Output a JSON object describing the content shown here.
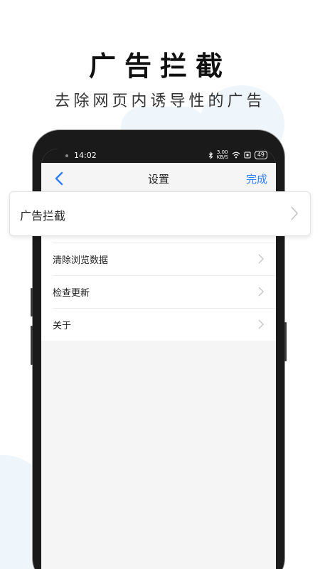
{
  "promo": {
    "title": "广告拦截",
    "subtitle": "去除网页内诱导性的广告"
  },
  "status_bar": {
    "time": "14:02",
    "net_speed_value": "3.00",
    "net_speed_unit": "KB/S",
    "battery": "49"
  },
  "nav": {
    "title": "设置",
    "done_label": "完成"
  },
  "highlight": {
    "label": "广告拦截"
  },
  "settings": {
    "items": [
      {
        "label": "清除浏览数据"
      },
      {
        "label": "检查更新"
      },
      {
        "label": "关于"
      }
    ]
  },
  "icons": {
    "back": "chevron-left-icon",
    "row": "chevron-right-icon"
  },
  "colors": {
    "accent": "#2f7df6",
    "screen_bg": "#f5f5f5",
    "phone_frame": "#1a1a1a"
  }
}
